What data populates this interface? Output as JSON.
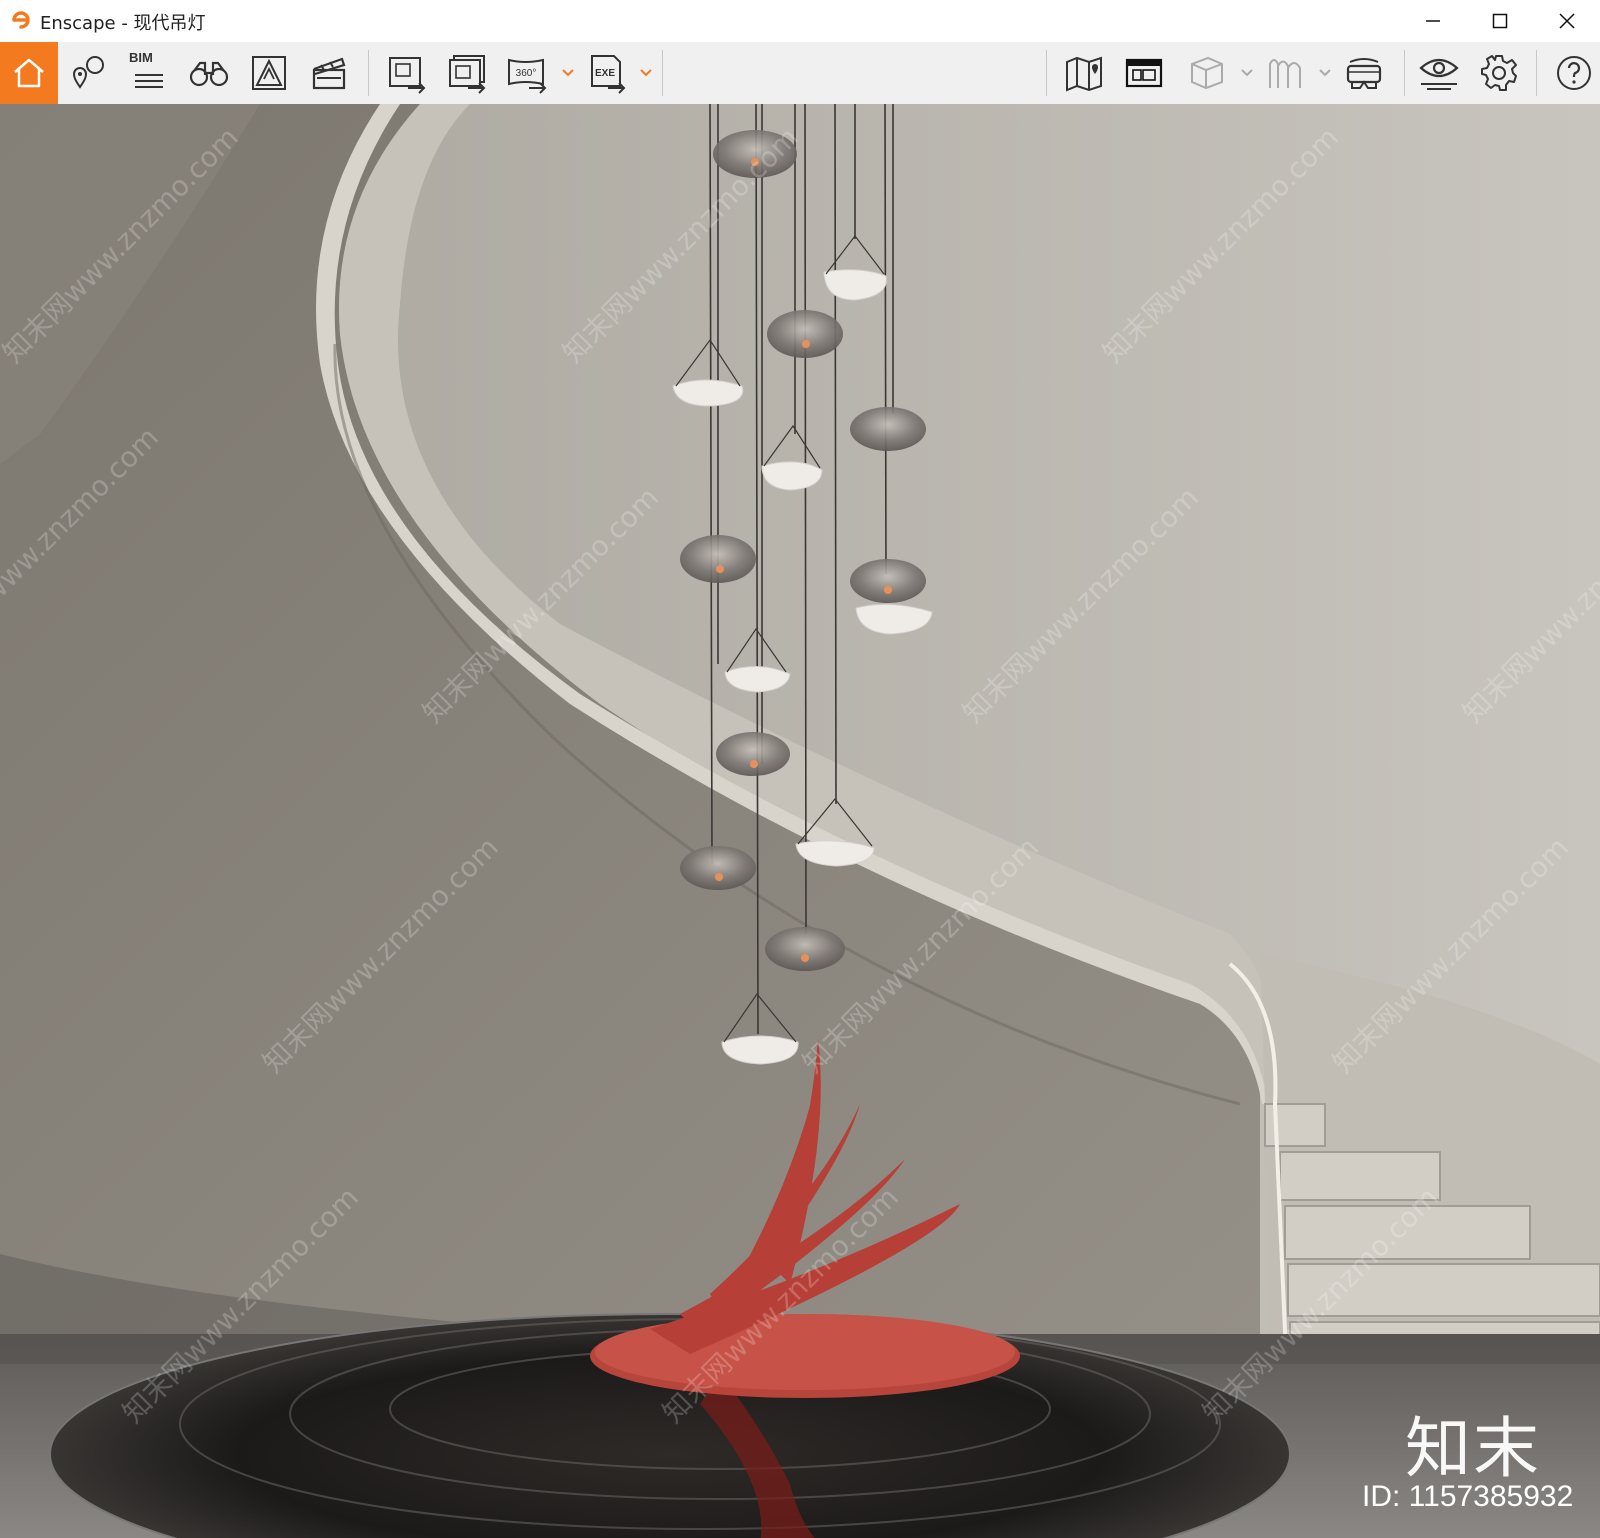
{
  "window": {
    "app_name": "Enscape",
    "separator": " - ",
    "document_name": "现代吊灯",
    "accent_color": "#f47a20"
  },
  "toolbar": {
    "bim_label": "BIM",
    "icons": [
      "home-icon",
      "location-pin-icon",
      "bim-icon",
      "binoculars-icon",
      "visual-settings-icon",
      "clapperboard-icon",
      "screenshot-icon",
      "batch-render-icon",
      "panorama-360-icon",
      "export-exe-icon",
      "map-icon",
      "asset-library-icon",
      "cube-icon",
      "material-icon",
      "vr-headset-icon",
      "eye-icon",
      "gear-icon",
      "help-icon"
    ],
    "panorama_label": "360°",
    "exe_label": "EXE"
  },
  "watermark": {
    "text": "知末网www.znzmo.com",
    "brand": "知末",
    "image_id": "ID: 1157385932"
  }
}
